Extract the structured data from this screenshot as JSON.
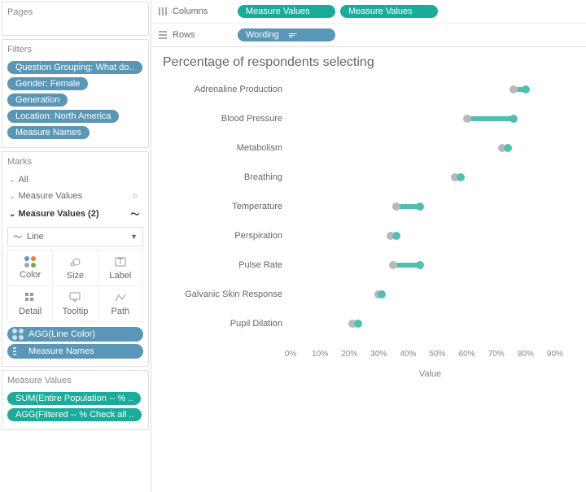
{
  "shelves": {
    "columns_label": "Columns",
    "rows_label": "Rows",
    "columns_pills": [
      "Measure Values",
      "Measure Values"
    ],
    "rows_pills": [
      "Wording"
    ]
  },
  "pages": {
    "title": "Pages"
  },
  "filters": {
    "title": "Filters",
    "items": [
      "Question Grouping: What do..",
      "Gender: Female",
      "Generation",
      "Location: North America",
      "Measure Names"
    ]
  },
  "marks": {
    "title": "Marks",
    "all": "All",
    "mv1": "Measure Values",
    "mv2": "Measure Values (2)",
    "mark_type": "Line",
    "cells": [
      "Color",
      "Size",
      "Label",
      "Detail",
      "Tooltip",
      "Path"
    ],
    "applied": [
      {
        "glyph": "dots",
        "label": "AGG(Line Color)"
      },
      {
        "glyph": "legend",
        "label": "Measure Names"
      }
    ]
  },
  "measure_values": {
    "title": "Measure Values",
    "items": [
      "SUM(Entire Population -- % ..",
      "AGG(Filtered -- % Check all .."
    ]
  },
  "chart": {
    "title": "Percentage of respondents selecting",
    "axis_label": "Value",
    "colors": {
      "teal": "#4fc0b0",
      "gray": "#b9b9b9"
    }
  },
  "chart_data": {
    "type": "bar",
    "title": "Percentage of respondents selecting",
    "xlabel": "Value",
    "ylabel": "",
    "xlim": [
      0,
      95
    ],
    "ticks": [
      0,
      10,
      20,
      30,
      40,
      50,
      60,
      70,
      80,
      90
    ],
    "categories": [
      "Adrenaline Production",
      "Blood Pressure",
      "Metabolism",
      "Breathing",
      "Temperature",
      "Perspiration",
      "Pulse Rate",
      "Galvanic Skin Response",
      "Pupil Dilation"
    ],
    "series": [
      {
        "name": "Entire Population",
        "color": "#b9b9b9",
        "values": [
          76,
          60,
          72,
          56,
          36,
          34,
          35,
          30,
          21
        ]
      },
      {
        "name": "Filtered",
        "color": "#4fc0b0",
        "values": [
          80,
          76,
          74,
          58,
          44,
          36,
          44,
          31,
          23
        ]
      }
    ]
  }
}
